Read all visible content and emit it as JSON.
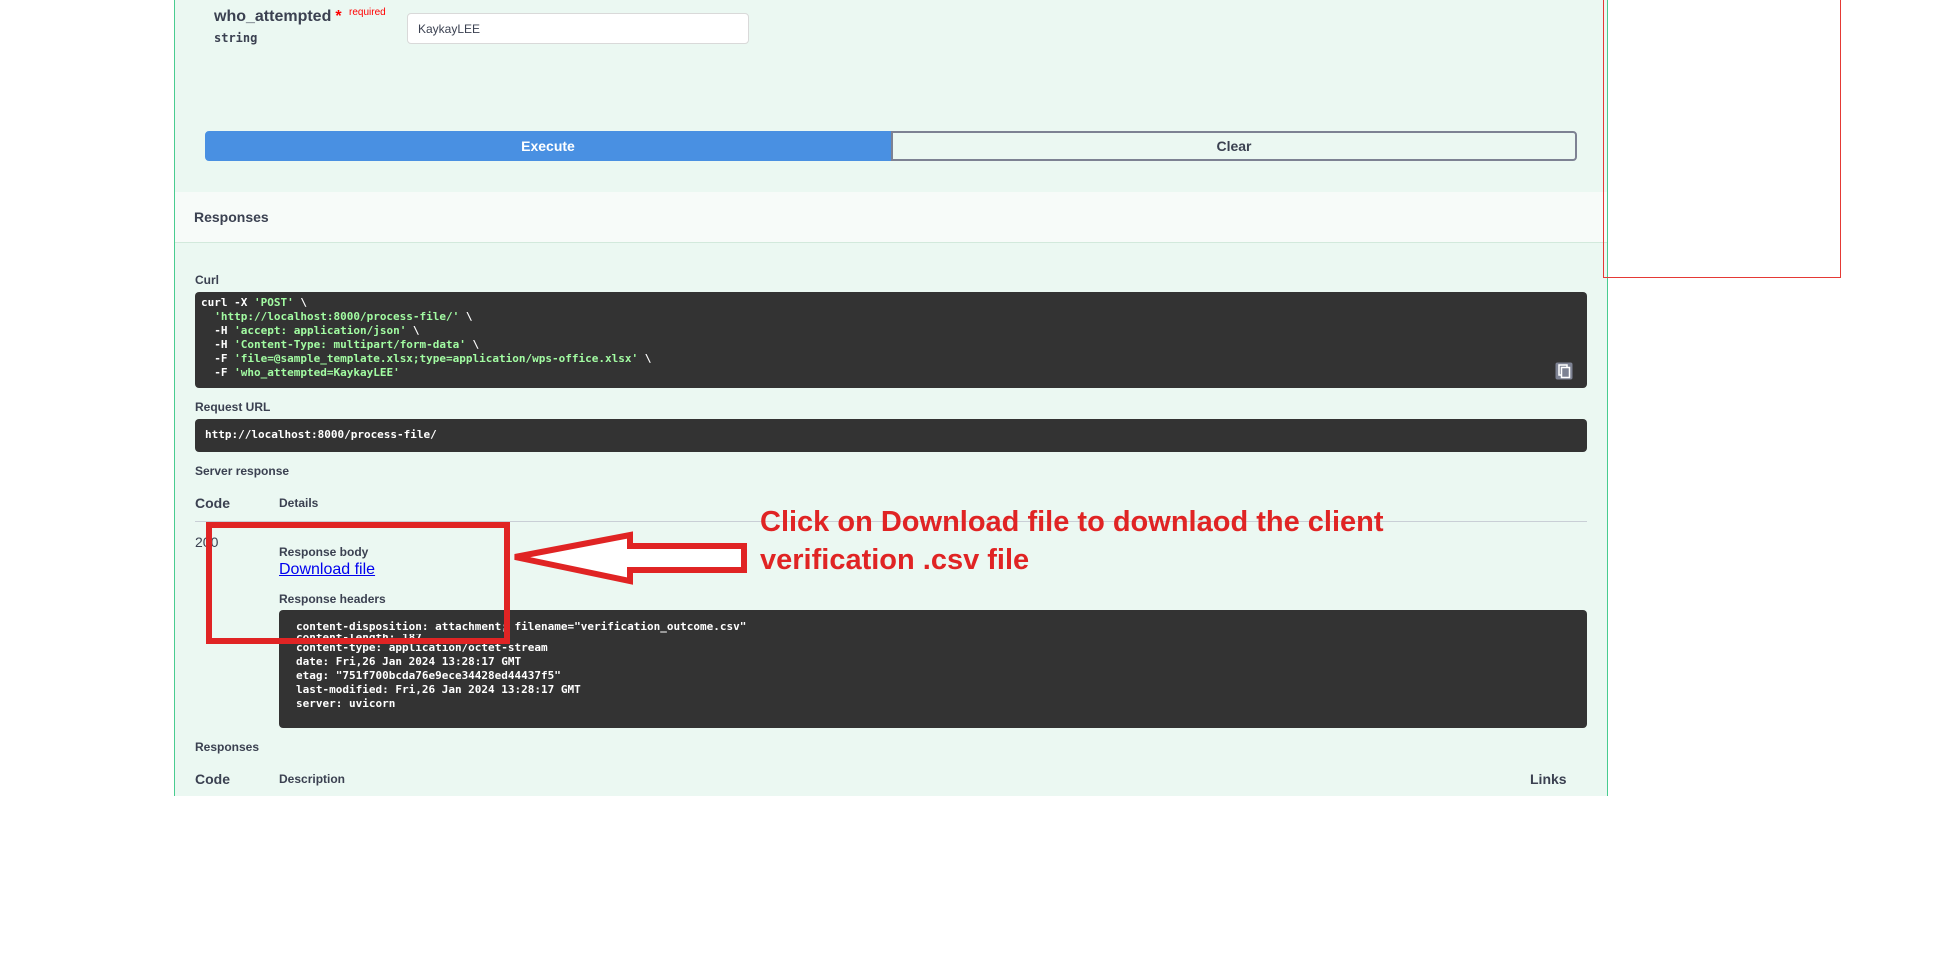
{
  "parameter": {
    "name": "who_attempted",
    "required_star": "*",
    "required_label": "required",
    "type": "string",
    "value": "KaykayLEE"
  },
  "actions": {
    "execute_label": "Execute",
    "clear_label": "Clear"
  },
  "responses_section": {
    "title": "Responses"
  },
  "curl": {
    "label": "Curl",
    "line1_cmd": "curl -X ",
    "line1_str": "'POST'",
    "line1_end": " \\",
    "line2_str": "'http://localhost:8000/process-file/'",
    "line2_end": " \\",
    "line3_cmd": "  -H ",
    "line3_str": "'accept: application/json'",
    "line3_end": " \\",
    "line4_cmd": "  -H ",
    "line4_str": "'Content-Type: multipart/form-data'",
    "line4_end": " \\",
    "line5_cmd": "  -F ",
    "line5_str": "'file=@sample_template.xlsx;type=application/wps-office.xlsx'",
    "line5_end": " \\",
    "line6_cmd": "  -F ",
    "line6_str": "'who_attempted=KaykayLEE'"
  },
  "request_url": {
    "label": "Request URL",
    "value": "http://localhost:8000/process-file/"
  },
  "server_response": {
    "label": "Server response",
    "col_code": "Code",
    "col_details": "Details",
    "code": "200",
    "body_label": "Response body",
    "download_link": "Download file",
    "headers_label": "Response headers",
    "headers": [
      "content-disposition: attachment; filename=\"verification_outcome.csv\"",
      "content-length: 187",
      "content-type: application/octet-stream",
      "date: Fri,26 Jan 2024 13:28:17 GMT",
      "etag: \"751f700bcda76e9ece34428ed44437f5\"",
      "last-modified: Fri,26 Jan 2024 13:28:17 GMT",
      "server: uvicorn"
    ]
  },
  "responses_table": {
    "label": "Responses",
    "col_code": "Code",
    "col_description": "Description",
    "col_links": "Links"
  },
  "annotation": {
    "line1": "Click on Download file to downlaod the client",
    "line2": "verification .csv file",
    "color": "#e02424"
  },
  "colors": {
    "panel_bg": "#ebf8f2",
    "panel_border": "#49cc90",
    "execute_bg": "#4990e2",
    "code_bg": "#333333"
  }
}
